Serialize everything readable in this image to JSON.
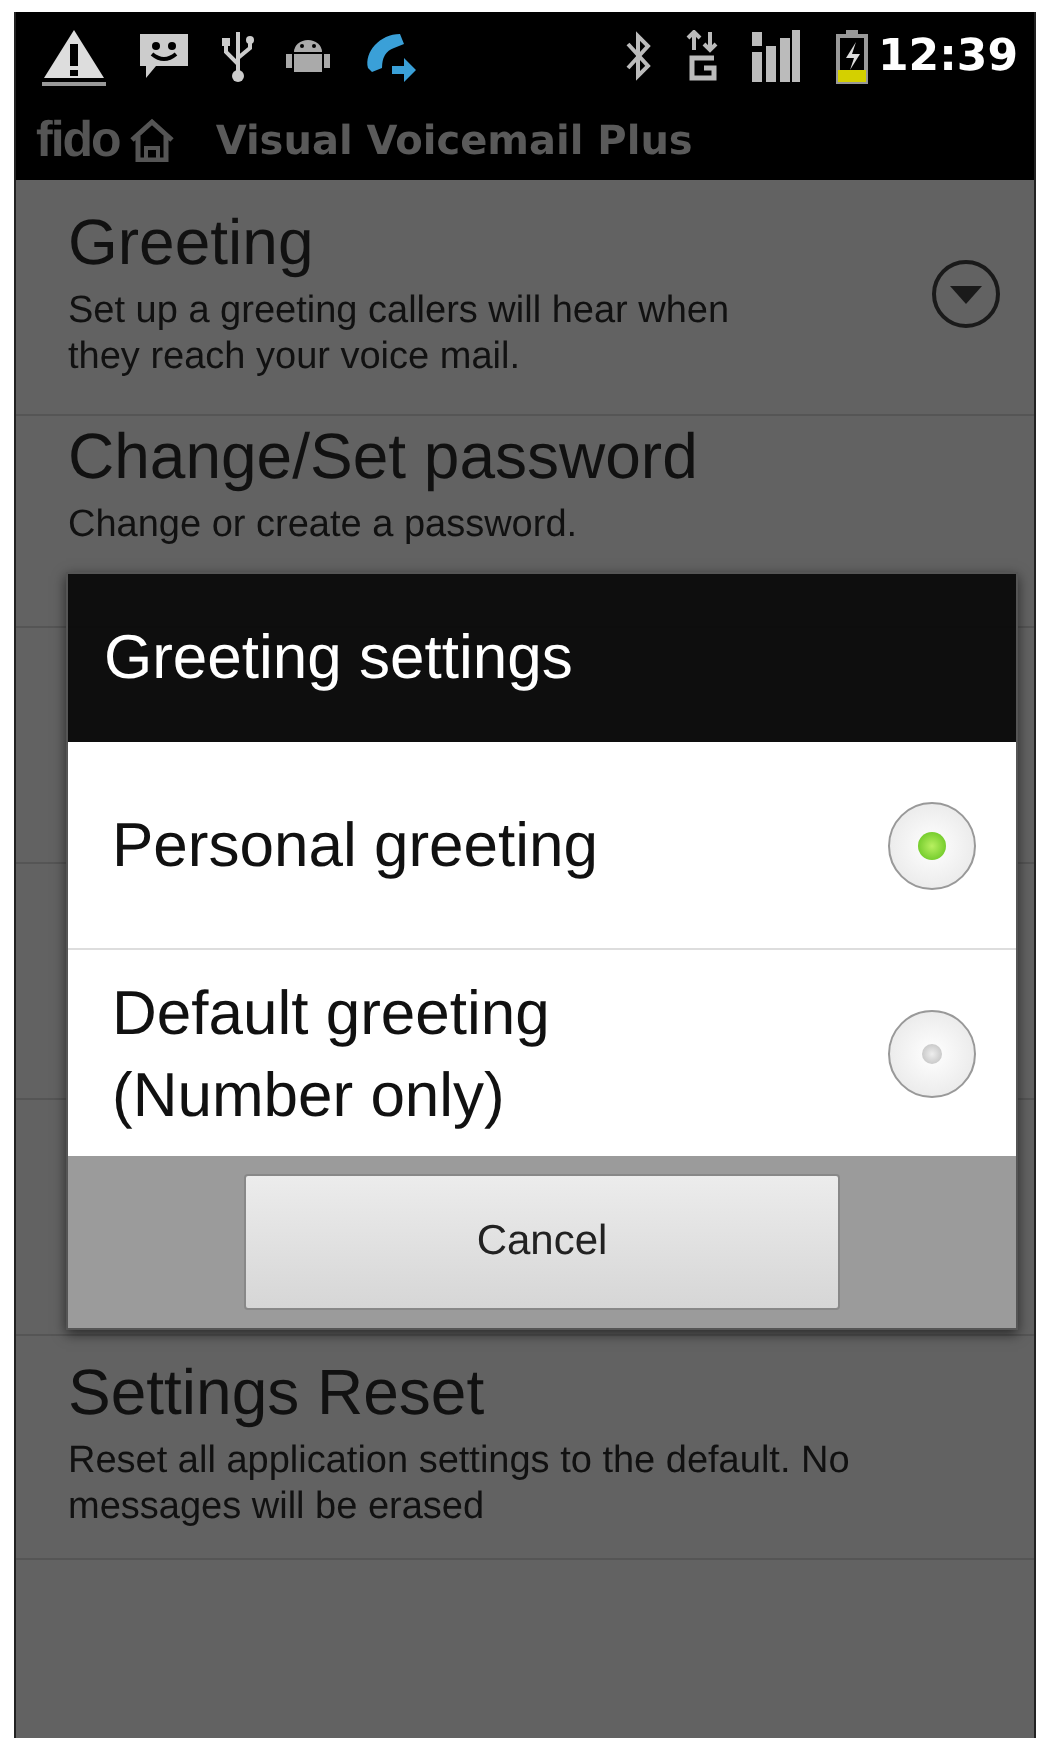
{
  "status_bar": {
    "time": "12:39"
  },
  "title_bar": {
    "logo": "fido",
    "title": "Visual Voicemail Plus"
  },
  "settings": [
    {
      "title": "Greeting",
      "description": "Set up a greeting callers will hear when they reach your voice mail.",
      "kind": "dropdown"
    },
    {
      "title": "Change/Set password",
      "description": "Change or create a password.",
      "kind": "plain"
    },
    {
      "title": "Settings Reset",
      "description": "Reset all application settings to the default. No messages will be erased",
      "kind": "plain"
    }
  ],
  "dialog": {
    "title": "Greeting settings",
    "options": [
      {
        "label": "Personal greeting",
        "selected": true
      },
      {
        "label": "Default greeting\n(Number only)",
        "selected": false
      }
    ],
    "buttons": [
      "Cancel"
    ]
  }
}
